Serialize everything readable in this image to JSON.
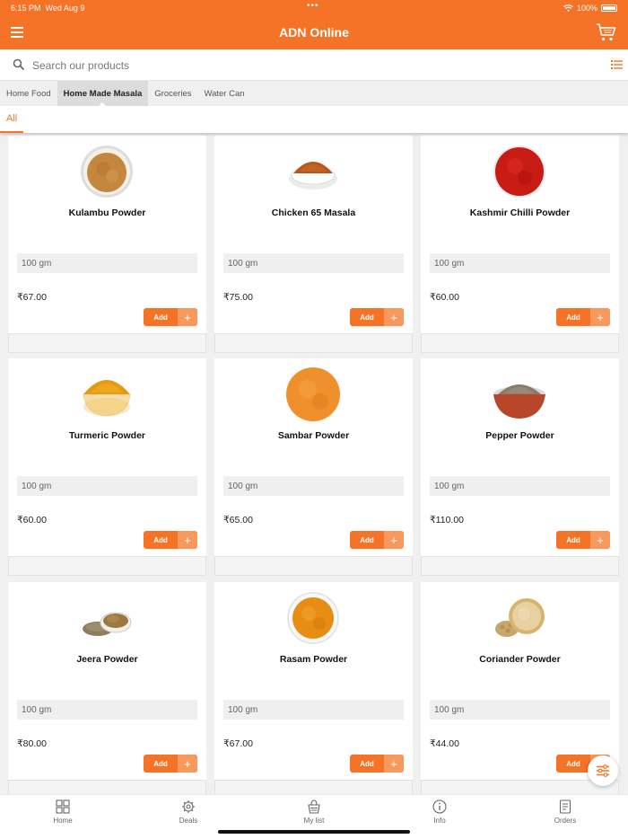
{
  "status_bar": {
    "time": "6:15 PM",
    "date": "Wed Aug 9",
    "battery": "100%"
  },
  "app": {
    "title": "ADN Online",
    "accent_color": "#f47326"
  },
  "search": {
    "placeholder": "Search our products"
  },
  "categories": [
    {
      "label": "Home Food",
      "active": false
    },
    {
      "label": "Home Made Masala",
      "active": true
    },
    {
      "label": "Groceries",
      "active": false
    },
    {
      "label": "Water Can",
      "active": false
    }
  ],
  "subtabs": [
    {
      "label": "All",
      "active": true
    }
  ],
  "products": [
    {
      "name": "Kulambu Powder",
      "size": "100 gm",
      "price": "₹67.00",
      "add_label": "Add",
      "plus": "+",
      "icon": "kulambu-powder-image"
    },
    {
      "name": "Chicken 65 Masala",
      "size": "100 gm",
      "price": "₹75.00",
      "add_label": "Add",
      "plus": "+",
      "icon": "chicken-65-masala-image"
    },
    {
      "name": "Kashmir Chilli Powder",
      "size": "100 gm",
      "price": "₹60.00",
      "add_label": "Add",
      "plus": "+",
      "icon": "kashmir-chilli-powder-image"
    },
    {
      "name": "Turmeric Powder",
      "size": "100 gm",
      "price": "₹60.00",
      "add_label": "Add",
      "plus": "+",
      "icon": "turmeric-powder-image"
    },
    {
      "name": "Sambar Powder",
      "size": "100 gm",
      "price": "₹65.00",
      "add_label": "Add",
      "plus": "+",
      "icon": "sambar-powder-image"
    },
    {
      "name": "Pepper Powder",
      "size": "100 gm",
      "price": "₹110.00",
      "add_label": "Add",
      "plus": "+",
      "icon": "pepper-powder-image"
    },
    {
      "name": "Jeera Powder",
      "size": "100 gm",
      "price": "₹80.00",
      "add_label": "Add",
      "plus": "+",
      "icon": "jeera-powder-image"
    },
    {
      "name": "Rasam Powder",
      "size": "100 gm",
      "price": "₹67.00",
      "add_label": "Add",
      "plus": "+",
      "icon": "rasam-powder-image"
    },
    {
      "name": "Coriander Powder",
      "size": "100 gm",
      "price": "₹44.00",
      "add_label": "Add",
      "plus": "+",
      "icon": "coriander-powder-image"
    }
  ],
  "bottom_nav": [
    {
      "label": "Home",
      "icon": "grid-icon"
    },
    {
      "label": "Deals",
      "icon": "gear-icon"
    },
    {
      "label": "My list",
      "icon": "basket-icon"
    },
    {
      "label": "Info",
      "icon": "info-icon"
    },
    {
      "label": "Orders",
      "icon": "orders-icon"
    }
  ]
}
